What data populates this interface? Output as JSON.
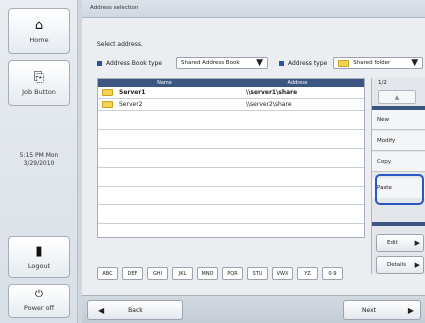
{
  "nav": {
    "home_label": "Home",
    "job_label": "Job Button",
    "time": "5:15 PM  Mon",
    "date": "3/29/2010",
    "logout_label": "Logout",
    "power_label": "Power off"
  },
  "title": "Address selection",
  "prompt": "Select address.",
  "filters": {
    "book_type_label": "Address Book type",
    "book_type_value": "Shared Address Book",
    "address_type_label": "Address type",
    "address_type_value": "Shared folder"
  },
  "list": {
    "columns": [
      "Name",
      "Address"
    ],
    "rows": [
      {
        "name": "Server1",
        "address": "\\\\server1\\share",
        "selected": true
      },
      {
        "name": "Server2",
        "address": "\\\\server2\\share",
        "selected": false
      }
    ]
  },
  "side": {
    "page": "1/2",
    "items": [
      "New",
      "Modify",
      "Copy",
      "Paste"
    ],
    "edit_label": "Edit",
    "details_label": "Details"
  },
  "alphabet": [
    "ABC",
    "DEF",
    "GHI",
    "JKL",
    "MNO",
    "PQR",
    "STU",
    "VWX",
    "YZ",
    "0-9"
  ],
  "footer": {
    "back_label": "Back",
    "next_label": "Next"
  },
  "colors": {
    "accent": "#2b53a7",
    "header": "#3b5680",
    "highlight": "#2b57c4",
    "folder": "#f4d44e"
  }
}
